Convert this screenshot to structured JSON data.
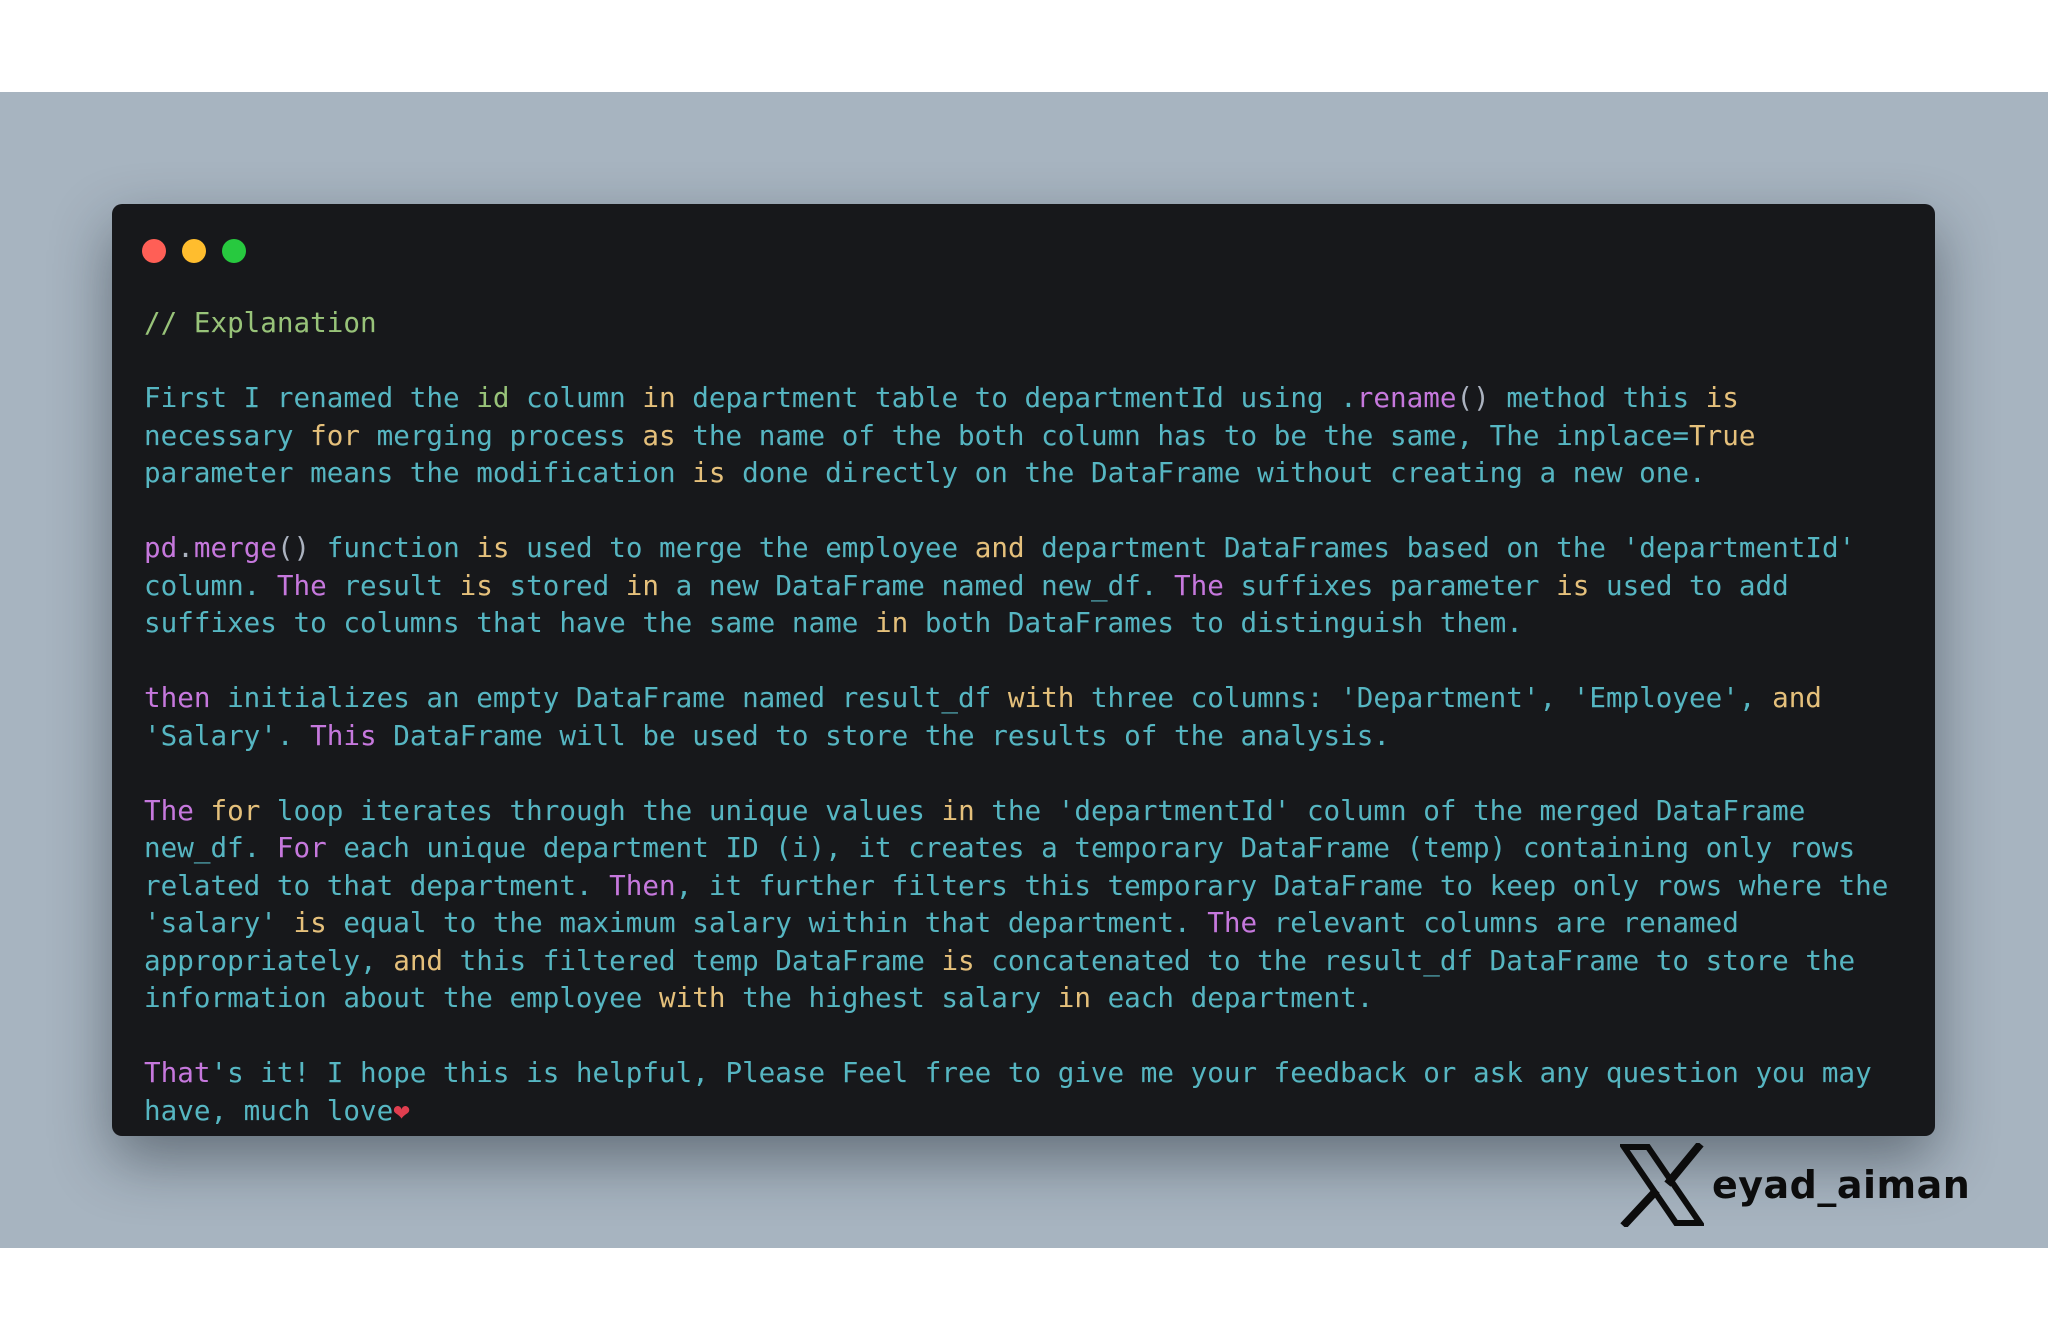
{
  "window": {
    "traffic_lights": [
      {
        "name": "close",
        "color": "#ff5f56"
      },
      {
        "name": "minimize",
        "color": "#ffbd2e"
      },
      {
        "name": "maximize",
        "color": "#27c93f"
      }
    ]
  },
  "colors": {
    "backdrop": "#a7b4c0",
    "editor_background": "#17181b",
    "text": "#56b6c2",
    "keyword": "#e5c07b",
    "highlight": "#c678dd",
    "comment": "#98c379"
  },
  "code": {
    "lines": [
      [
        [
          "c",
          "// Explanation"
        ]
      ],
      [],
      [
        [
          "t",
          "First I renamed the "
        ],
        [
          "g",
          "id"
        ],
        [
          "t",
          " column "
        ],
        [
          "k",
          "in"
        ],
        [
          "t",
          " department table to departmentId using ."
        ],
        [
          "p",
          "rename"
        ],
        [
          "u",
          "()"
        ],
        [
          "t",
          " method this "
        ],
        [
          "k",
          "is"
        ]
      ],
      [
        [
          "t",
          "necessary "
        ],
        [
          "k",
          "for"
        ],
        [
          "t",
          " merging process "
        ],
        [
          "k",
          "as"
        ],
        [
          "t",
          " the name of the both column has to be the same, The inplace="
        ],
        [
          "k",
          "True"
        ]
      ],
      [
        [
          "t",
          "parameter means the modification "
        ],
        [
          "k",
          "is"
        ],
        [
          "t",
          " done directly on the DataFrame without creating a new one."
        ]
      ],
      [],
      [
        [
          "p",
          "pd"
        ],
        [
          "u",
          "."
        ],
        [
          "p",
          "merge"
        ],
        [
          "u",
          "()"
        ],
        [
          "t",
          " function "
        ],
        [
          "k",
          "is"
        ],
        [
          "t",
          " used to merge the employee "
        ],
        [
          "k",
          "and"
        ],
        [
          "t",
          " department DataFrames based on the 'departmentId'"
        ]
      ],
      [
        [
          "t",
          "column. "
        ],
        [
          "p",
          "The"
        ],
        [
          "t",
          " result "
        ],
        [
          "k",
          "is"
        ],
        [
          "t",
          " stored "
        ],
        [
          "k",
          "in"
        ],
        [
          "t",
          " a new DataFrame named new_df. "
        ],
        [
          "p",
          "The"
        ],
        [
          "t",
          " suffixes parameter "
        ],
        [
          "k",
          "is"
        ],
        [
          "t",
          " used to add"
        ]
      ],
      [
        [
          "t",
          "suffixes to columns that have the same name "
        ],
        [
          "k",
          "in"
        ],
        [
          "t",
          " both DataFrames to distinguish them."
        ]
      ],
      [],
      [
        [
          "p",
          "then"
        ],
        [
          "t",
          " initializes an empty DataFrame named result_df "
        ],
        [
          "k",
          "with"
        ],
        [
          "t",
          " three columns: 'Department', 'Employee', "
        ],
        [
          "k",
          "and"
        ]
      ],
      [
        [
          "t",
          "'Salary'. "
        ],
        [
          "p",
          "This"
        ],
        [
          "t",
          " DataFrame will be used to store the results of the analysis."
        ]
      ],
      [],
      [
        [
          "p",
          "The"
        ],
        [
          "t",
          " "
        ],
        [
          "k",
          "for"
        ],
        [
          "t",
          " loop iterates through the unique values "
        ],
        [
          "k",
          "in"
        ],
        [
          "t",
          " the 'departmentId' column of the merged DataFrame"
        ]
      ],
      [
        [
          "t",
          "new_df. "
        ],
        [
          "p",
          "For"
        ],
        [
          "t",
          " each unique department ID (i), it creates a temporary DataFrame (temp) containing only rows"
        ]
      ],
      [
        [
          "t",
          "related to that department. "
        ],
        [
          "p",
          "Then"
        ],
        [
          "t",
          ", it further filters this temporary DataFrame to keep only rows where the"
        ]
      ],
      [
        [
          "t",
          "'salary' "
        ],
        [
          "k",
          "is"
        ],
        [
          "t",
          " equal to the maximum salary within that department. "
        ],
        [
          "p",
          "The"
        ],
        [
          "t",
          " relevant columns are renamed"
        ]
      ],
      [
        [
          "t",
          "appropriately, "
        ],
        [
          "k",
          "and"
        ],
        [
          "t",
          " this filtered temp DataFrame "
        ],
        [
          "k",
          "is"
        ],
        [
          "t",
          " concatenated to the result_df DataFrame to store the"
        ]
      ],
      [
        [
          "t",
          "information about the employee "
        ],
        [
          "k",
          "with"
        ],
        [
          "t",
          " the highest salary "
        ],
        [
          "k",
          "in"
        ],
        [
          "t",
          " each department."
        ]
      ],
      [],
      [
        [
          "p",
          "That"
        ],
        [
          "t",
          "'s it! I hope this is helpful, Please Feel free to give me your feedback or ask any question you may"
        ]
      ],
      [
        [
          "t",
          "have, much love"
        ],
        [
          "h",
          "❤"
        ]
      ]
    ]
  },
  "watermark": {
    "icon": "x-logo-icon",
    "handle": "eyad_aiman"
  }
}
